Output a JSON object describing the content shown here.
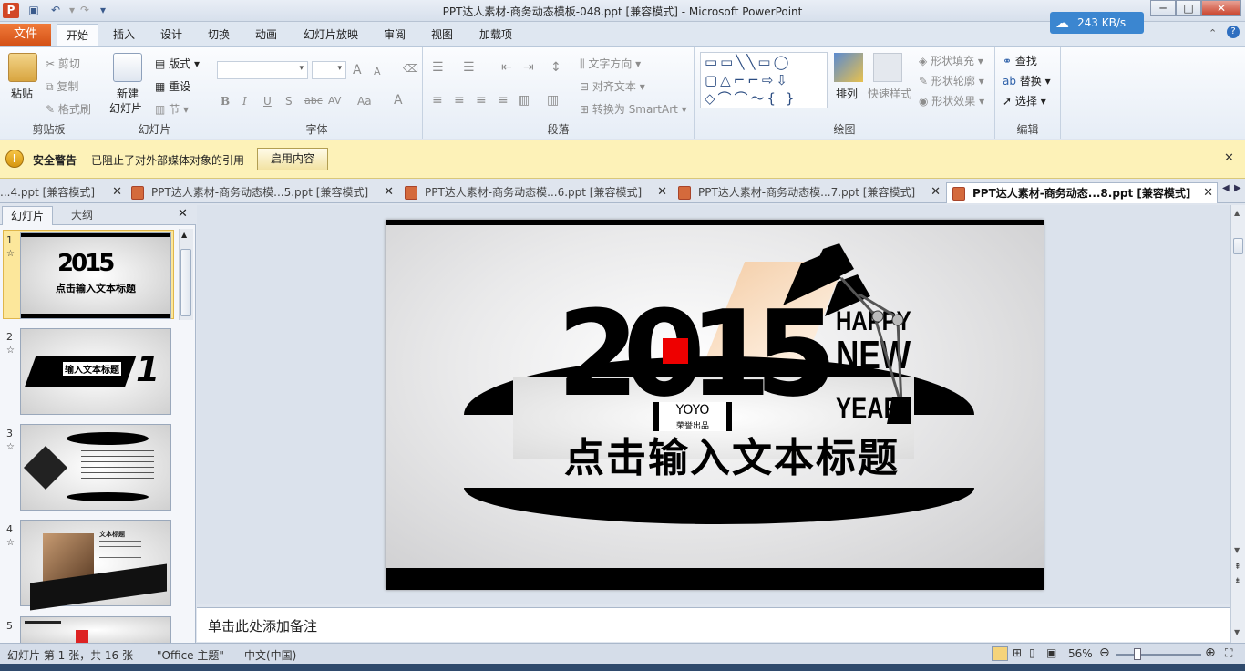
{
  "window": {
    "title": "PPT达人素材-商务动态模板-048.ppt [兼容模式]  -  Microsoft PowerPoint",
    "speed": "243 KB/s",
    "min": "─",
    "max": "□",
    "close": "✕"
  },
  "ribbon_tabs": [
    "文件",
    "开始",
    "插入",
    "设计",
    "切换",
    "动画",
    "幻灯片放映",
    "审阅",
    "视图",
    "加载项"
  ],
  "ribbon": {
    "clipboard": {
      "paste": "粘贴",
      "cut": "剪切",
      "copy": "复制",
      "format_painter": "格式刷",
      "label": "剪贴板"
    },
    "slides": {
      "new_slide": "新建",
      "new_slide2": "幻灯片",
      "layout": "版式",
      "reset": "重设",
      "section": "节",
      "label": "幻灯片"
    },
    "font": {
      "label": "字体",
      "bold": "B",
      "italic": "I",
      "underline": "U",
      "shadow": "S",
      "strike": "abc",
      "spacing": "AV",
      "case": "Aa",
      "color": "A",
      "grow": "A",
      "shrink": "A"
    },
    "paragraph": {
      "text_direction": "文字方向",
      "align_text": "对齐文本",
      "smartart": "转换为 SmartArt",
      "label": "段落"
    },
    "drawing": {
      "arrange": "排列",
      "quick_styles": "快速样式",
      "shape_fill": "形状填充",
      "shape_outline": "形状轮廓",
      "shape_effects": "形状效果",
      "label": "绘图"
    },
    "editing": {
      "find": "查找",
      "replace": "替换",
      "select": "选择",
      "label": "编辑"
    }
  },
  "security": {
    "title": "安全警告",
    "message": "已阻止了对外部媒体对象的引用",
    "button": "启用内容"
  },
  "doc_tabs": [
    {
      "label": "...4.ppt [兼容模式]"
    },
    {
      "label": "PPT达人素材-商务动态模...5.ppt [兼容模式]"
    },
    {
      "label": "PPT达人素材-商务动态模...6.ppt [兼容模式]"
    },
    {
      "label": "PPT达人素材-商务动态模...7.ppt [兼容模式]"
    },
    {
      "label": "PPT达人素材-商务动态...8.ppt [兼容模式]"
    }
  ],
  "panel": {
    "tab_slides": "幻灯片",
    "tab_outline": "大纲",
    "close": "✕"
  },
  "thumbs": [
    {
      "num": "1",
      "text": "点击输入文本标题"
    },
    {
      "num": "2",
      "text": "输入文本标题"
    },
    {
      "num": "3",
      "text": ""
    },
    {
      "num": "4",
      "text": "文本标题"
    },
    {
      "num": "5",
      "text": ""
    }
  ],
  "slide": {
    "year": "2015",
    "happy": "HAPPY",
    "new": "NEW",
    "year_word": "YEAR",
    "badge_main": "YOYO",
    "badge_sub": "荣誉出品",
    "title": "点击输入文本标题"
  },
  "notes": {
    "placeholder": "单击此处添加备注"
  },
  "status": {
    "slide_info": "幻灯片 第 1 张，共 16 张",
    "theme": "\"Office 主题\"",
    "lang": "中文(中国)",
    "zoom": "56%"
  }
}
